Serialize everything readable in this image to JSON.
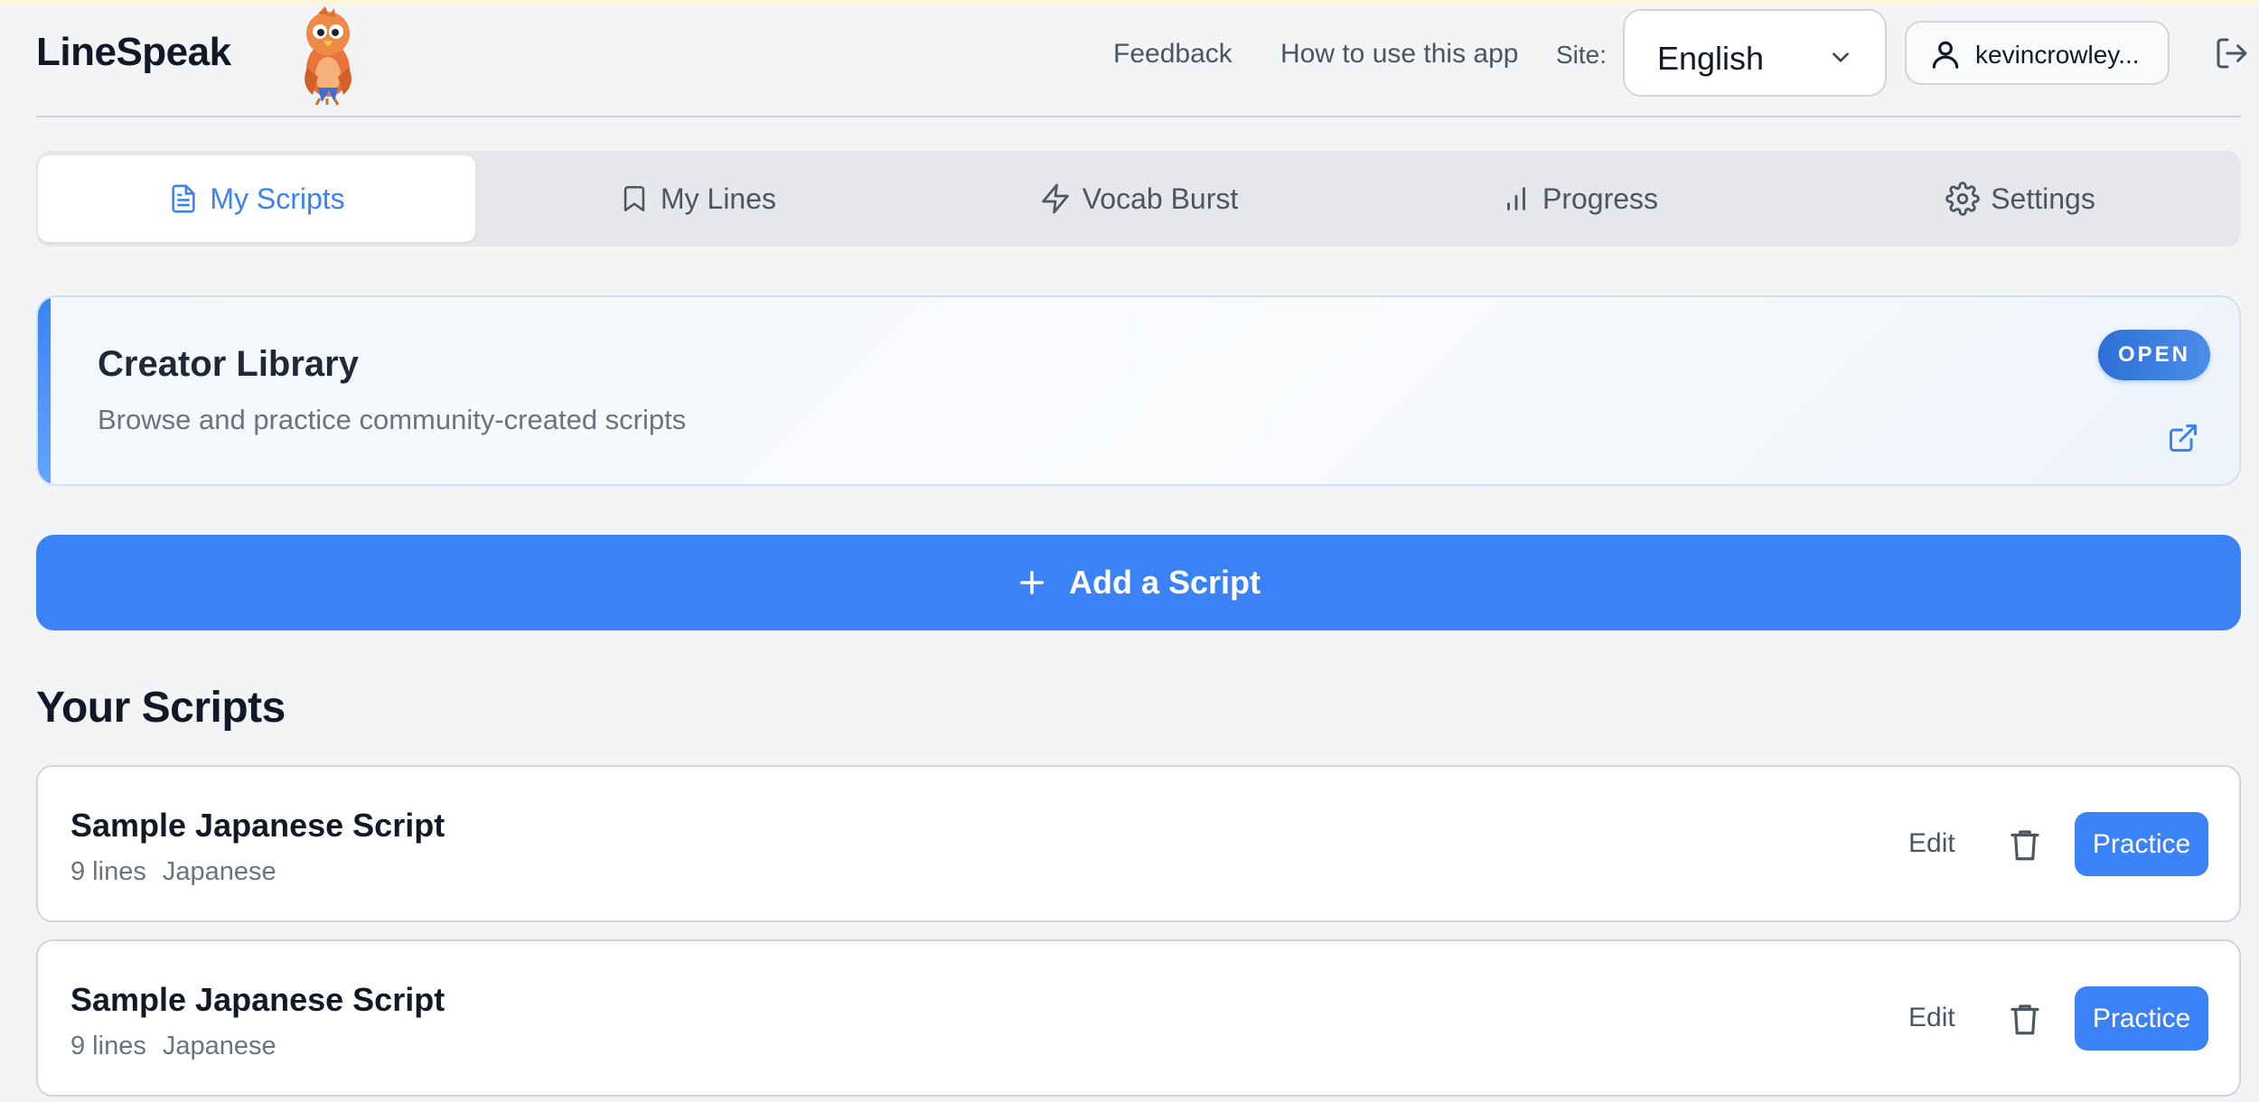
{
  "app": {
    "name": "LineSpeak"
  },
  "header": {
    "feedback_label": "Feedback",
    "howto_label": "How to use this app",
    "site_label": "Site:",
    "site_value": "English",
    "username": "kevincrowley..."
  },
  "tabs": [
    {
      "label": "My Scripts",
      "icon": "document-icon",
      "active": true
    },
    {
      "label": "My Lines",
      "icon": "bookmark-icon",
      "active": false
    },
    {
      "label": "Vocab Burst",
      "icon": "lightning-icon",
      "active": false
    },
    {
      "label": "Progress",
      "icon": "bar-chart-icon",
      "active": false
    },
    {
      "label": "Settings",
      "icon": "gear-icon",
      "active": false
    }
  ],
  "library": {
    "title": "Creator Library",
    "description": "Browse and practice community-created scripts",
    "badge": "OPEN"
  },
  "add_script_label": "Add a Script",
  "scripts_title": "Your Scripts",
  "scripts": [
    {
      "name": "Sample Japanese Script",
      "lines": "9 lines",
      "language": "Japanese",
      "edit_label": "Edit",
      "practice_label": "Practice"
    },
    {
      "name": "Sample Japanese Script",
      "lines": "9 lines",
      "language": "Japanese",
      "edit_label": "Edit",
      "practice_label": "Practice"
    }
  ],
  "colors": {
    "accent": "#3b82f6",
    "background": "#f3f4f6"
  }
}
